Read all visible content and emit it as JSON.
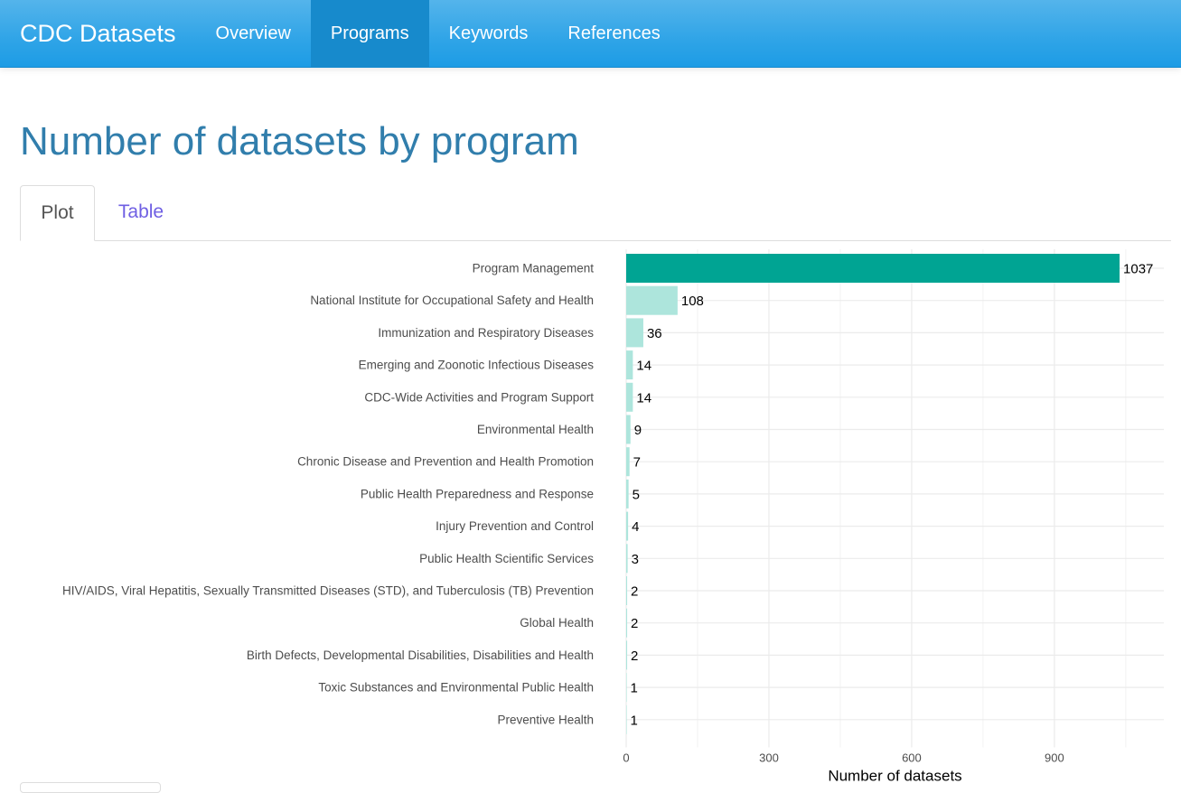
{
  "navbar": {
    "brand": "CDC Datasets",
    "items": [
      {
        "label": "Overview",
        "active": false
      },
      {
        "label": "Programs",
        "active": true
      },
      {
        "label": "Keywords",
        "active": false
      },
      {
        "label": "References",
        "active": false
      }
    ],
    "colors": {
      "background": "#2fa4e7",
      "active": "#178acc",
      "text": "#ffffff"
    }
  },
  "page": {
    "title": "Number of datasets by program",
    "tabs": [
      {
        "label": "Plot",
        "active": true
      },
      {
        "label": "Table",
        "active": false
      }
    ]
  },
  "chart_data": {
    "type": "bar",
    "orientation": "horizontal",
    "categories": [
      "Program Management",
      "National Institute for Occupational Safety and Health",
      "Immunization and Respiratory Diseases",
      "Emerging and Zoonotic Infectious Diseases",
      "CDC-Wide Activities and Program Support",
      "Environmental Health",
      "Chronic Disease and Prevention and Health Promotion",
      "Public Health Preparedness and Response",
      "Injury Prevention and Control",
      "Public Health Scientific Services",
      "HIV/AIDS, Viral Hepatitis, Sexually Transmitted Diseases (STD), and Tuberculosis (TB) Prevention",
      "Global Health",
      "Birth Defects, Developmental Disabilities, Disabilities and Health",
      "Toxic Substances and Environmental Public Health",
      "Preventive Health"
    ],
    "values": [
      1037,
      108,
      36,
      14,
      14,
      9,
      7,
      5,
      4,
      3,
      2,
      2,
      2,
      1,
      1
    ],
    "data_labels": [
      "1037",
      "108",
      "36",
      "14",
      "14",
      "9",
      "7",
      "5",
      "4",
      "3",
      "2",
      "2",
      "2",
      "1",
      "1"
    ],
    "xlabel": "Number of datasets",
    "ylabel": "",
    "xticks": [
      0,
      300,
      600,
      900
    ],
    "xtick_labels": [
      "0",
      "300",
      "600",
      "900"
    ],
    "xlim": [
      0,
      1130
    ],
    "grid": true,
    "legend": "none",
    "colors": {
      "highlight": "#00a493",
      "bars": "#ade5dc"
    }
  }
}
